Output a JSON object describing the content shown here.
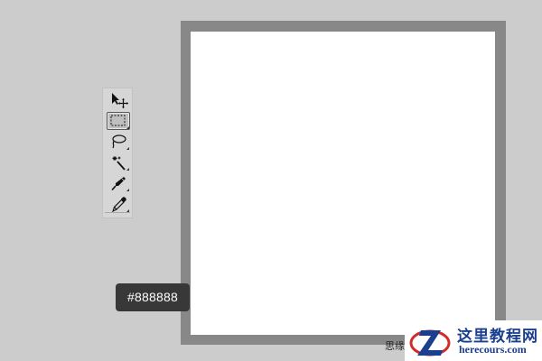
{
  "toolbar": {
    "tools": [
      {
        "name": "move-tool",
        "icon": "move-arrow-icon",
        "selected": false,
        "has_flyout": false
      },
      {
        "name": "rectangular-marquee-tool",
        "icon": "marquee-icon",
        "selected": true,
        "has_flyout": true
      },
      {
        "name": "lasso-tool",
        "icon": "lasso-icon",
        "selected": false,
        "has_flyout": true
      },
      {
        "name": "magic-wand-tool",
        "icon": "magic-wand-icon",
        "selected": false,
        "has_flyout": true
      },
      {
        "name": "crop-tool",
        "icon": "crop-knife-icon",
        "selected": false,
        "has_flyout": true
      },
      {
        "name": "eyedropper-tool",
        "icon": "eyedropper-icon",
        "selected": false,
        "has_flyout": true
      }
    ]
  },
  "canvas": {
    "frame_color": "#888888",
    "fill_color": "#ffffff"
  },
  "color_tooltip": {
    "text": "#888888"
  },
  "footer": {
    "text": "思缘"
  },
  "watermark": {
    "title": "这里教程网",
    "url": "herecours.com"
  },
  "colors": {
    "background": "#cccccc",
    "tooltip_bg": "#383838",
    "brand_blue": "#1b3f8f",
    "brand_red": "#d42a2a"
  }
}
